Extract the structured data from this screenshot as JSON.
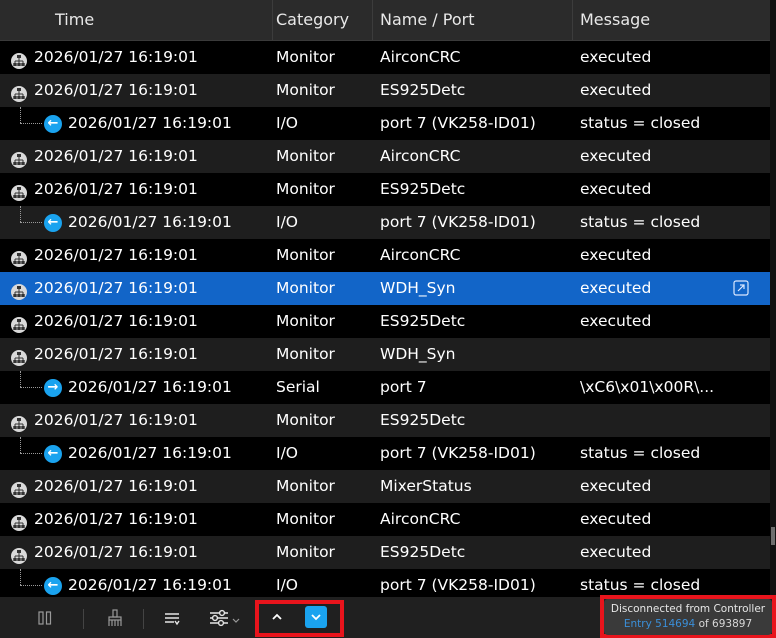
{
  "columns": {
    "time": "Time",
    "category": "Category",
    "name_port": "Name / Port",
    "message": "Message"
  },
  "rows": [
    {
      "kind": "monitor",
      "time": "2026/01/27 16:19:01",
      "category": "Monitor",
      "name": "AirconCRC",
      "message": "executed"
    },
    {
      "kind": "monitor",
      "time": "2026/01/27 16:19:01",
      "category": "Monitor",
      "name": "ES925Detc",
      "message": "executed"
    },
    {
      "kind": "io-in",
      "time": "2026/01/27 16:19:01",
      "category": "I/O",
      "name": "port 7 (VK258-ID01)",
      "message": "status = closed"
    },
    {
      "kind": "monitor",
      "time": "2026/01/27 16:19:01",
      "category": "Monitor",
      "name": "AirconCRC",
      "message": "executed"
    },
    {
      "kind": "monitor",
      "time": "2026/01/27 16:19:01",
      "category": "Monitor",
      "name": "ES925Detc",
      "message": "executed"
    },
    {
      "kind": "io-in",
      "time": "2026/01/27 16:19:01",
      "category": "I/O",
      "name": "port 7 (VK258-ID01)",
      "message": "status = closed"
    },
    {
      "kind": "monitor",
      "time": "2026/01/27 16:19:01",
      "category": "Monitor",
      "name": "AirconCRC",
      "message": "executed"
    },
    {
      "kind": "monitor",
      "time": "2026/01/27 16:19:01",
      "category": "Monitor",
      "name": "WDH_Syn",
      "message": "executed",
      "selected": true
    },
    {
      "kind": "monitor",
      "time": "2026/01/27 16:19:01",
      "category": "Monitor",
      "name": "ES925Detc",
      "message": "executed"
    },
    {
      "kind": "monitor",
      "time": "2026/01/27 16:19:01",
      "category": "Monitor",
      "name": "WDH_Syn",
      "message": ""
    },
    {
      "kind": "io-out",
      "time": "2026/01/27 16:19:01",
      "category": "Serial",
      "name": "port 7",
      "message": "\\xC6\\x01\\x00R\\..."
    },
    {
      "kind": "monitor",
      "time": "2026/01/27 16:19:01",
      "category": "Monitor",
      "name": "ES925Detc",
      "message": ""
    },
    {
      "kind": "io-in",
      "time": "2026/01/27 16:19:01",
      "category": "I/O",
      "name": "port 7 (VK258-ID01)",
      "message": "status = closed"
    },
    {
      "kind": "monitor",
      "time": "2026/01/27 16:19:01",
      "category": "Monitor",
      "name": "MixerStatus",
      "message": "executed"
    },
    {
      "kind": "monitor",
      "time": "2026/01/27 16:19:01",
      "category": "Monitor",
      "name": "AirconCRC",
      "message": "executed"
    },
    {
      "kind": "monitor",
      "time": "2026/01/27 16:19:01",
      "category": "Monitor",
      "name": "ES925Detc",
      "message": "executed"
    },
    {
      "kind": "io-in",
      "time": "2026/01/27 16:19:01",
      "category": "I/O",
      "name": "port 7 (VK258-ID01)",
      "message": "status = closed"
    }
  ],
  "toolbar": {
    "icons": [
      "pause-icon",
      "clear-icon",
      "wrap-lines-icon",
      "filter-settings-icon",
      "chevron-down-icon",
      "scroll-up-icon",
      "scroll-down-icon"
    ]
  },
  "status": {
    "line1": "Disconnected from Controller",
    "entry_label": "Entry",
    "entry_number": "514694",
    "of_label": "of",
    "total": "693897"
  },
  "colors": {
    "selection": "#1265c8",
    "accent_blue": "#1aa3ef",
    "highlight_red": "#e8141c"
  }
}
